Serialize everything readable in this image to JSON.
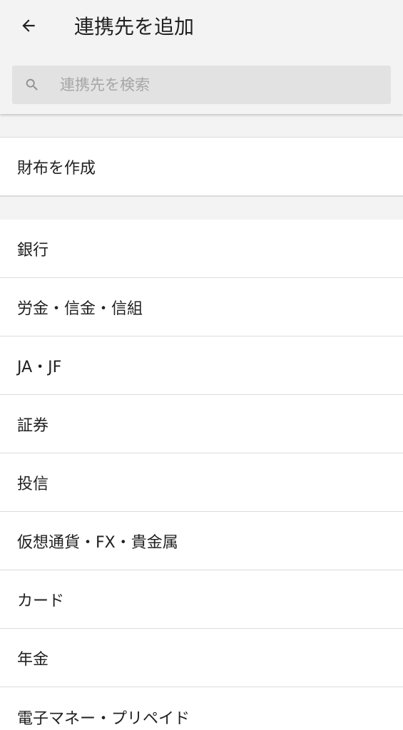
{
  "header": {
    "title": "連携先を追加",
    "back_icon": "arrow-left-icon"
  },
  "search": {
    "placeholder": "連携先を検索",
    "value": "",
    "icon": "search-icon"
  },
  "create_wallet": {
    "label": "財布を作成"
  },
  "categories": [
    {
      "label": "銀行"
    },
    {
      "label": "労金・信金・信組"
    },
    {
      "label": "JA・JF"
    },
    {
      "label": "証券"
    },
    {
      "label": "投信"
    },
    {
      "label": "仮想通貨・FX・貴金属"
    },
    {
      "label": "カード"
    },
    {
      "label": "年金"
    },
    {
      "label": "電子マネー・プリペイド"
    }
  ],
  "colors": {
    "header_bg": "#f3f3f3",
    "search_bg": "#e2e2e2",
    "text": "#212121",
    "placeholder": "#a6a6a6",
    "divider": "#dcdcdc"
  }
}
